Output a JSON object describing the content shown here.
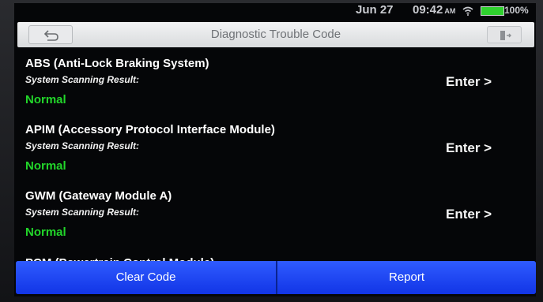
{
  "status_bar": {
    "date": "Jun 27",
    "time": "09:42",
    "ampm": "AM",
    "battery": "100%"
  },
  "header": {
    "title": "Diagnostic Trouble Code"
  },
  "icons": {
    "back": "back-arrow-icon",
    "exit": "exit-door-icon",
    "wifi": "wifi-icon",
    "battery": "battery-icon"
  },
  "modules": [
    {
      "name": "ABS (Anti-Lock Braking System)",
      "scan_label": "System Scanning Result:",
      "result": "Normal",
      "enter_label": "Enter >"
    },
    {
      "name": "APIM (Accessory Protocol Interface Module)",
      "scan_label": "System Scanning Result:",
      "result": "Normal",
      "enter_label": "Enter >"
    },
    {
      "name": "GWM (Gateway Module A)",
      "scan_label": "System Scanning Result:",
      "result": "Normal",
      "enter_label": "Enter >"
    },
    {
      "name": "PCM (Powertrain Control Module)"
    }
  ],
  "footer": {
    "clear_label": "Clear Code",
    "report_label": "Report"
  },
  "colors": {
    "normal": "#22d62a",
    "button_blue": "#1235e6"
  }
}
